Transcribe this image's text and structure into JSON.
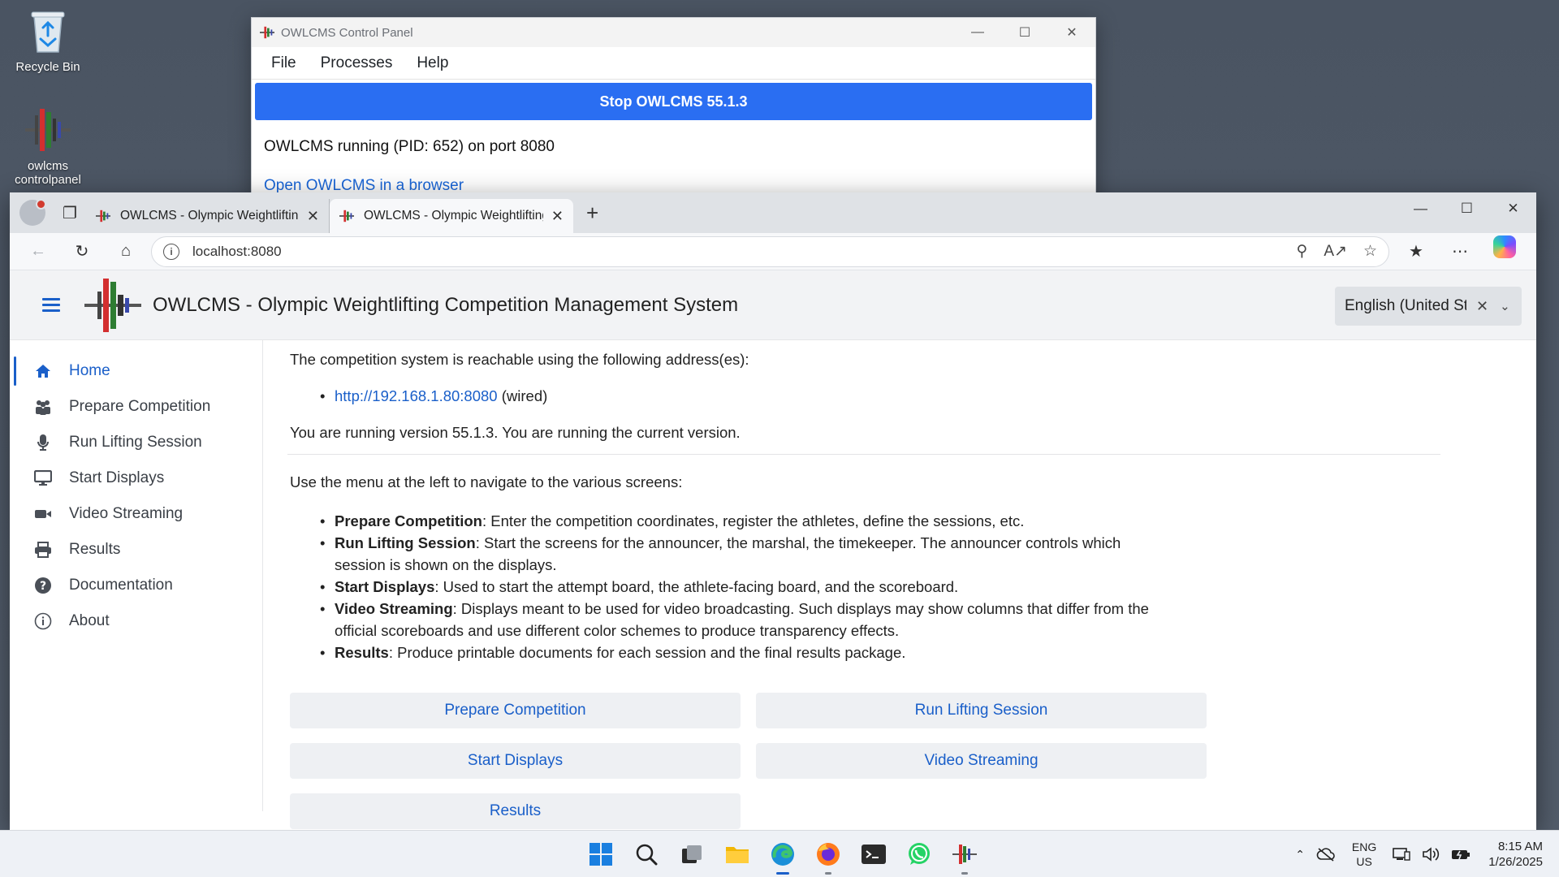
{
  "desktop": {
    "icons": [
      {
        "label": "Recycle Bin",
        "icon": "recycle-bin-icon"
      },
      {
        "label": "owlcms controlpanel",
        "icon": "owlcms-icon"
      }
    ]
  },
  "control_panel": {
    "title": "OWLCMS Control Panel",
    "menu": [
      "File",
      "Processes",
      "Help"
    ],
    "stop_button": "Stop OWLCMS 55.1.3",
    "status": "OWLCMS running (PID: 652) on port 8080",
    "open_link": "Open OWLCMS in a browser"
  },
  "browser": {
    "tabs": [
      {
        "title": "OWLCMS - Olympic Weightlifting",
        "active": false
      },
      {
        "title": "OWLCMS - Olympic Weightlifting",
        "active": true
      }
    ],
    "url": "localhost:8080"
  },
  "app": {
    "title": "OWLCMS - Olympic Weightlifting Competition Management System",
    "language": "English (United St",
    "nav": [
      {
        "label": "Home",
        "icon": "home-icon",
        "active": true
      },
      {
        "label": "Prepare Competition",
        "icon": "users-icon"
      },
      {
        "label": "Run Lifting Session",
        "icon": "microphone-icon"
      },
      {
        "label": "Start Displays",
        "icon": "desktop-icon"
      },
      {
        "label": "Video Streaming",
        "icon": "video-icon"
      },
      {
        "label": "Results",
        "icon": "printer-icon"
      },
      {
        "label": "Documentation",
        "icon": "question-icon"
      },
      {
        "label": "About",
        "icon": "info-icon"
      }
    ],
    "reachable_text": "The competition system is reachable using the following address(es):",
    "address_link": "http://192.168.1.80:8080",
    "address_note": " (wired)",
    "version_text": "You are running version 55.1.3. You are running the current version.",
    "menu_text": "Use the menu at the left to navigate to the various screens:",
    "features": [
      {
        "name": "Prepare Competition",
        "desc": ": Enter the competition coordinates, register the athletes, define the sessions, etc."
      },
      {
        "name": "Run Lifting Session",
        "desc": ": Start the screens for the announcer, the marshal, the timekeeper. The announcer controls which session is shown on the displays."
      },
      {
        "name": "Start Displays",
        "desc": ": Used to start the attempt board, the athlete-facing board, and the scoreboard."
      },
      {
        "name": "Video Streaming",
        "desc": ": Displays meant to be used for video broadcasting. Such displays may show columns that differ from the official scoreboards and use different color schemes to produce transparency effects."
      },
      {
        "name": "Results",
        "desc": ": Produce printable documents for each session and the final results package."
      }
    ],
    "buttons": [
      "Prepare Competition",
      "Run Lifting Session",
      "Start Displays",
      "Video Streaming",
      "Results"
    ]
  },
  "taskbar": {
    "apps": [
      "start-icon",
      "search-icon",
      "task-view-icon",
      "file-explorer-icon",
      "edge-icon",
      "firefox-icon",
      "terminal-icon",
      "whatsapp-icon",
      "owlcms-icon"
    ],
    "lang_line1": "ENG",
    "lang_line2": "US",
    "time": "8:15 AM",
    "date": "1/26/2025"
  },
  "colors": {
    "accent": "#1a5fc9",
    "stop_button": "#2a6ef2"
  }
}
